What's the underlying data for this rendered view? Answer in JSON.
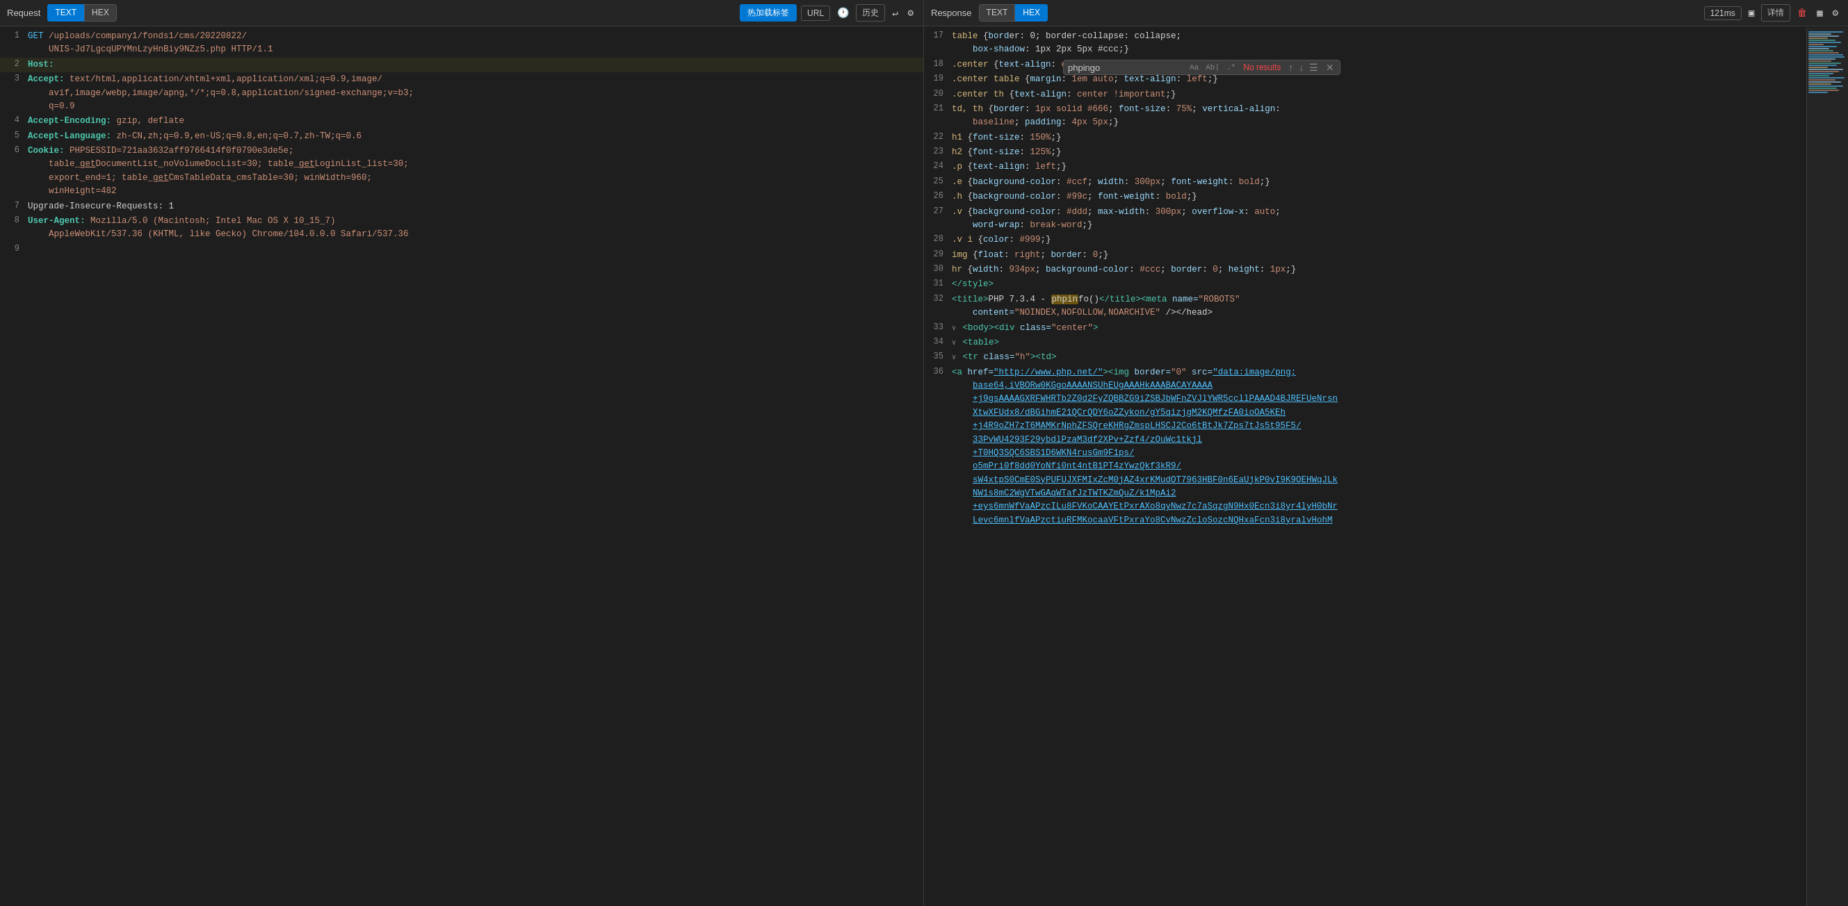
{
  "left": {
    "label": "Request",
    "btn_text": "TEXT",
    "btn_hex": "HEX",
    "btn_hotreload": "热加载标签",
    "btn_url": "URL",
    "btn_history": "历史",
    "lines": [
      {
        "num": 1,
        "parts": [
          {
            "text": "GET ",
            "class": "c-method"
          },
          {
            "text": "/uploads/company1/fonds1/cms/20220822/\nUNIS-Jd7LgcqUPYMnLzyHnBiy9NZz5.php HTTP/1.1",
            "class": "c-path"
          }
        ]
      },
      {
        "num": 2,
        "highlight": true,
        "parts": [
          {
            "text": "Host:",
            "class": "c-green-key"
          },
          {
            "text": " ",
            "class": "c-plain"
          }
        ]
      },
      {
        "num": 3,
        "parts": [
          {
            "text": "Accept: ",
            "class": "c-green-key"
          },
          {
            "text": "text/html,application/xhtml+xml,application/xml;q=0.9,image/\navif,image/webp,image/apng,*/*;q=0.8,application/signed-exchange;v=b3;\nq=0.9",
            "class": "c-val"
          }
        ]
      },
      {
        "num": 4,
        "parts": [
          {
            "text": "Accept-Encoding: ",
            "class": "c-green-key"
          },
          {
            "text": "gzip, deflate",
            "class": "c-val"
          }
        ]
      },
      {
        "num": 5,
        "parts": [
          {
            "text": "Accept-Language: ",
            "class": "c-green-key"
          },
          {
            "text": "zh-CN,zh;q=0.9,en-US;q=0.8,en;q=0.7,zh-TW;q=0.6",
            "class": "c-val"
          }
        ]
      },
      {
        "num": 6,
        "parts": [
          {
            "text": "Cookie: ",
            "class": "c-green-key"
          },
          {
            "text": "PHPSESSID=721aa3632aff9766414f0f0790e3de5e;\ntable_getDocumentList_noVolumeDocList=30; table_getLoginList_list=30;\nexport_end=1; table_getCmsTableData_cmsTable=30; winWidth=960;\nwinHeight=482",
            "class": "c-val"
          }
        ]
      },
      {
        "num": 7,
        "parts": [
          {
            "text": "Upgrade-Insecure-Requests: 1",
            "class": "c-plain"
          }
        ]
      },
      {
        "num": 8,
        "parts": [
          {
            "text": "User-Agent: ",
            "class": "c-green-key"
          },
          {
            "text": "Mozilla/5.0 (Macintosh; Intel Mac OS X 10_15_7)\nAppleWebKit/537.36 (KHTML, like Gecko) Chrome/104.0.0.0 Safari/537.36",
            "class": "c-val"
          }
        ]
      },
      {
        "num": 9,
        "parts": [
          {
            "text": "",
            "class": "c-plain"
          }
        ]
      }
    ]
  },
  "right": {
    "label": "Response",
    "btn_text": "TEXT",
    "btn_hex": "HEX",
    "timing": "121ms",
    "btn_detail": "详情",
    "search": {
      "placeholder": "phpingo",
      "no_results": "No results",
      "opts": [
        "Aa",
        "Ab|",
        ".*"
      ]
    },
    "lines": [
      {
        "num": 17,
        "parts": [
          {
            "text": "table {bor",
            "class": "c-plain"
          },
          {
            "text": "...",
            "class": "c-plain"
          }
        ],
        "raw": "table {bord"
      },
      {
        "num": 17,
        "raw_html": "table {bord<span class='c-plain'>er: 0; border-collapse: collapse; </span>",
        "display": "table {borde... box-shadow: 1px 2px 5px #ccc;}"
      },
      {
        "num": 18,
        "display": ".center {text-align: center;}"
      },
      {
        "num": 19,
        "display": ".center table {margin: 1em auto; text-align: left;}"
      },
      {
        "num": 20,
        "display": ".center th {text-align: center !important;}"
      },
      {
        "num": 21,
        "display": "td, th {border: 1px solid #666; font-size: 75%; vertical-align: baseline; padding: 4px 5px;}"
      },
      {
        "num": 22,
        "display": "h1 {font-size: 150%;}"
      },
      {
        "num": 23,
        "display": "h2 {font-size: 125%;}"
      },
      {
        "num": 24,
        "display": ".p {text-align: left;}"
      },
      {
        "num": 25,
        "display": ".e {background-color: #ccf; width: 300px; font-weight: bold;}"
      },
      {
        "num": 26,
        "display": ".h {background-color: #99c; font-weight: bold;}"
      },
      {
        "num": 27,
        "display": ".v {background-color: #ddd; max-width: 300px; overflow-x: auto; word-wrap: break-word;}"
      },
      {
        "num": 28,
        "display": ".v i {color: #999;}"
      },
      {
        "num": 29,
        "display": "img {float: right; border: 0;}"
      },
      {
        "num": 30,
        "display": "hr {width: 934px; background-color: #ccc; border: 0; height: 1px;}"
      },
      {
        "num": 31,
        "display": "</style>"
      },
      {
        "num": 32,
        "display": "<title>PHP 7.3.4 - phpinfo()</title><meta name=\"ROBOTS\" content=\"NOINDEX,NOFOLLOW,NOARCHIVE\" /></head>",
        "highlight_word": "phpin"
      },
      {
        "num": 33,
        "display": "∨ <body><div class=\"center\">"
      },
      {
        "num": 34,
        "display": "∨ <table>"
      },
      {
        "num": 35,
        "display": "∨ <tr class=\"h\"><td>"
      },
      {
        "num": 36,
        "display": "<a href=\"http://www.php.net/\"><img border=\"0\" src=\"data:image/png; base64,iVBORw0KGoAAAANSUhEUgAAAHkAAABACAYAAAA +j9gsAAAAGXRFWHRTb2Z0d2FyZQBBZG9iZSBJbWFnZVJlYWR5ccllPAAAD4BJREFUeNrsn XtwXFUdx8/dBGihmE21QCrQDY6oZZykon/gY5qizjgM2KQMfzFA0ioOA5KEh +j4R9oZH7zT6MAMKrNphZFSQreKHRgZmspLHSCJ2Co6tBtJk7Zps7tJs5t95F5/ 33PvWU4293F29ybdlPzaM3df2XPv+Zzf4/zOuWc1tkjl +T0HQ3SQC6SBS1D6WKN4rusGm9F1ps/ o5mPri0f8dd0YoNfi0nt4ntB1PT4zYwzQkf3kR9/ sW4xtpS0CmE0SyPUFUJXFMIxZcM0jAZ4xrKMudQT7963HBF0n6EaUjkP0vI9K9OEHWqJLk NW1s8mC2WgVTwGAqWTafJzTWTKZmQuZ/k1MpAi2 +eys6mnWfVaAPzcILu8FVKoCAAYEtPxrAXo8qyNwz7c7aSqzgN9Hx0Ecn3i8yr4lyH0bNr Levc6mnlfVaAPzctiuRFMKocaaVFtPxraYo8CvNwzZcloSozcNQHxaFcn3i8yralvHohM\""
      }
    ]
  }
}
